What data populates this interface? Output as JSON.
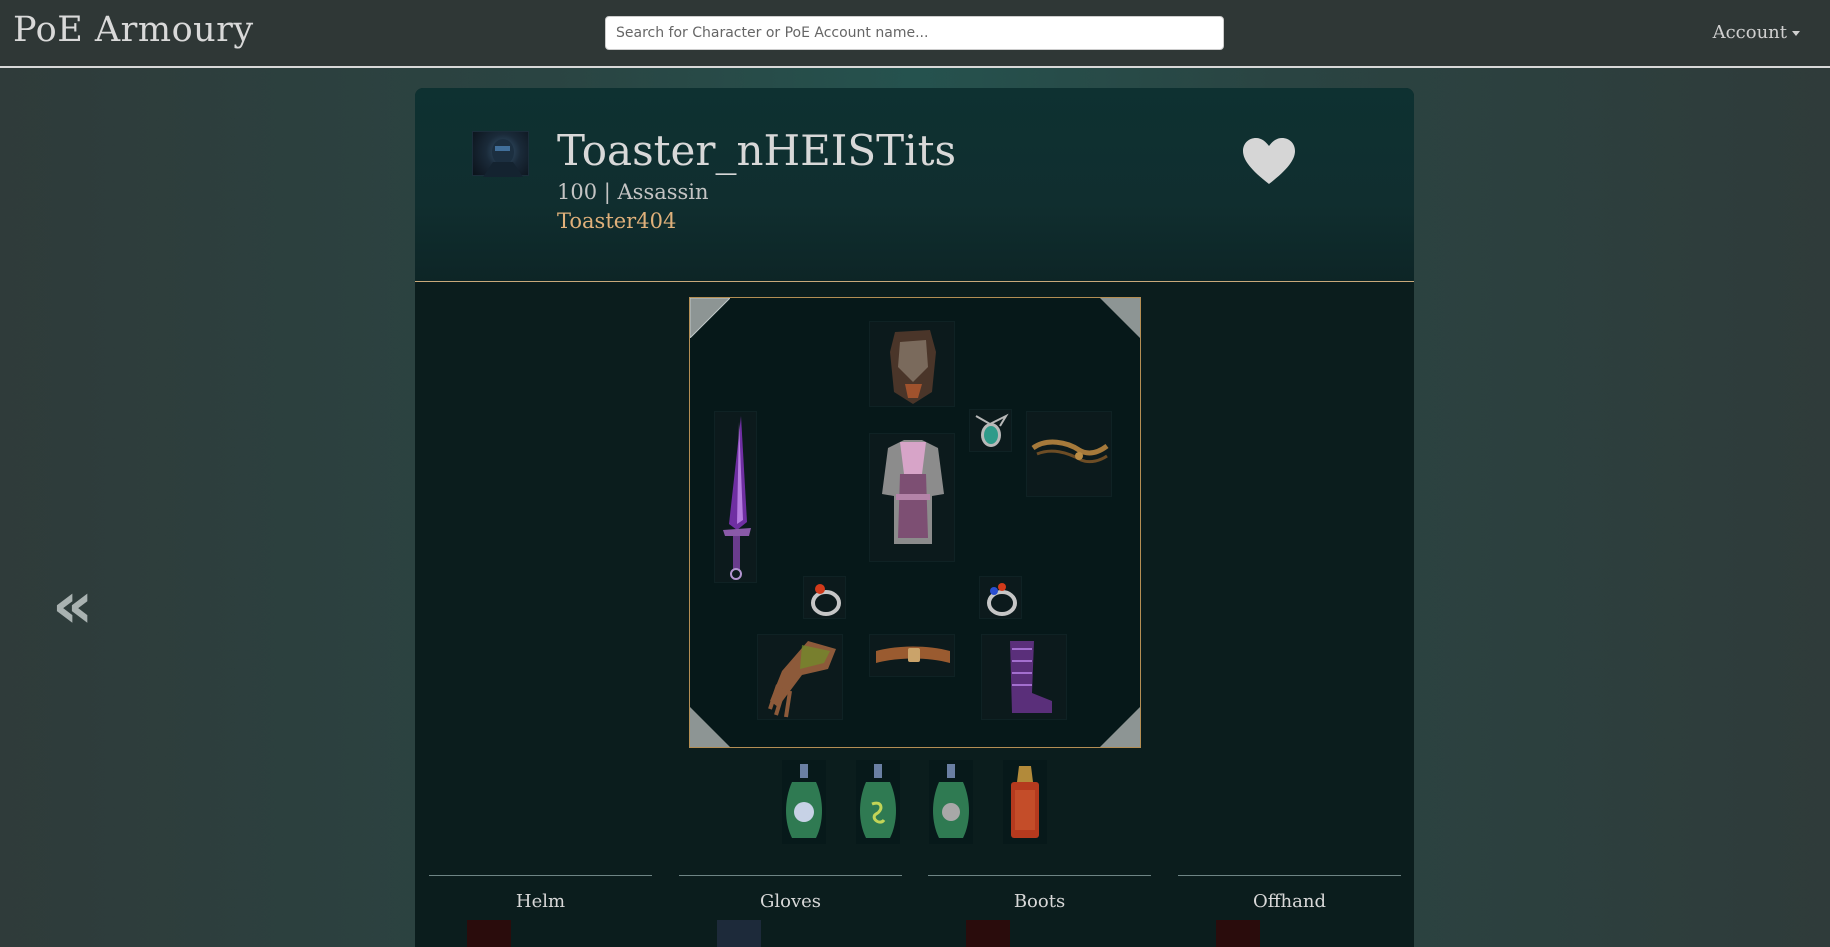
{
  "navbar": {
    "brand": "PoE Armoury",
    "search_placeholder": "Search for Character or PoE Account name...",
    "account_label": "Account"
  },
  "nav": {
    "prev_arrow": "«"
  },
  "character": {
    "name": "Toaster_nHEISTits",
    "level_class": "100 | Assassin",
    "account": "Toaster404"
  },
  "equipment": {
    "slots": [
      "helm-slot",
      "weapon-slot",
      "amulet-slot",
      "offhand-slot",
      "body-armour-slot",
      "left-ring-slot",
      "right-ring-slot",
      "gloves-slot",
      "belt-slot",
      "boots-slot"
    ]
  },
  "flasks": [
    "flask-1",
    "flask-2",
    "flask-3",
    "flask-4"
  ],
  "sections": [
    {
      "label": "Helm"
    },
    {
      "label": "Gloves"
    },
    {
      "label": "Boots"
    },
    {
      "label": "Offhand"
    }
  ],
  "colors": {
    "accent_gold": "#c9a97a",
    "account_name": "#e0b07a",
    "panel_bg": "#0b1d1d"
  }
}
